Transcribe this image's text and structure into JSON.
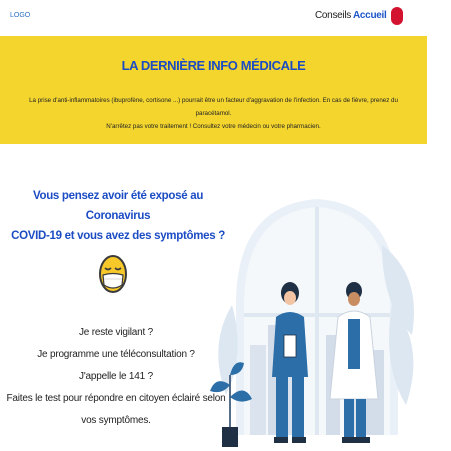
{
  "header": {
    "logo": "LOGO",
    "nav": {
      "conseils": "Conseils",
      "accueil": "Accueil"
    },
    "lang_color": "#d2122e"
  },
  "banner": {
    "title": "LA DERNIÈRE INFO MÉDICALE",
    "line1": "La prise d'anti-inflammatoires (ibuprofène, cortisone ...) pourrait être un facteur d'aggravation de l'infection. En cas de fièvre, prenez du paracétamol.",
    "line2": "N'arrêtez pas votre traitement ! Consultez votre médecin ou votre pharmacien.",
    "background": "#f4d52e",
    "title_color": "#1c4cc4"
  },
  "hero": {
    "question_line1": "Vous pensez avoir été exposé au Coronavirus",
    "question_line2": "COVID-19 et vous avez des symptômes ?",
    "emoji": "masked-face-icon",
    "steps": [
      "Je reste vigilant ?",
      "Je programme une téléconsultation ?",
      "J'appelle le 141 ?",
      "Faites le test pour répondre en citoyen éclairé selon",
      "vos symptômes."
    ]
  },
  "illustration": {
    "icon": "doctors-illustration-icon",
    "accent_color": "#2c6ea8"
  }
}
